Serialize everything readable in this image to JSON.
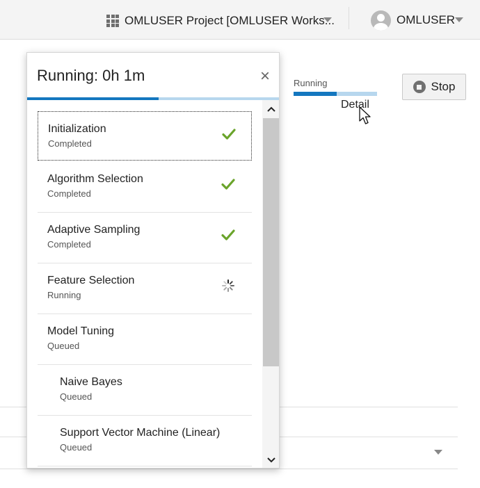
{
  "header": {
    "project_label": "OMLUSER Project [OMLUSER Works...",
    "project_icon": "grid-icon",
    "user_label": "OMLUSER",
    "user_icon": "avatar-icon"
  },
  "run": {
    "status_label": "Running",
    "progress_fraction": 0.52,
    "detail_link": "Detail",
    "stop_label": "Stop"
  },
  "popup": {
    "title": "Running: 0h 1m",
    "close_glyph": "×",
    "progress_fraction": 0.52,
    "steps": [
      {
        "name": "Initialization",
        "state": "Completed",
        "icon": "check-icon"
      },
      {
        "name": "Algorithm Selection",
        "state": "Completed",
        "icon": "check-icon"
      },
      {
        "name": "Adaptive Sampling",
        "state": "Completed",
        "icon": "check-icon"
      },
      {
        "name": "Feature Selection",
        "state": "Running",
        "icon": "spinner-icon"
      },
      {
        "name": "Model Tuning",
        "state": "Queued",
        "icon": ""
      },
      {
        "name": "Naive Bayes",
        "state": "Queued",
        "icon": ""
      },
      {
        "name": "Support Vector Machine (Linear)",
        "state": "Queued",
        "icon": ""
      }
    ]
  },
  "colors": {
    "accent": "#1477bf",
    "accent_light": "#b7d7ee",
    "check": "#6aa42b"
  }
}
